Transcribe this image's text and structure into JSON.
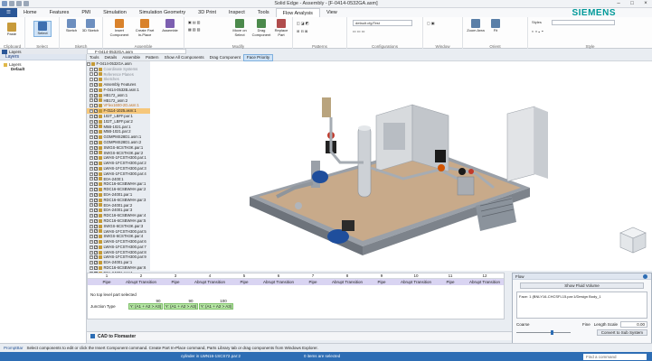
{
  "title": "Solid Edge - Assembly - [F-0414-0532GA.asm]",
  "brand": "SIEMENS",
  "menu_tabs": [
    "Home",
    "Features",
    "PMI",
    "Simulation",
    "Simulation Geometry",
    "3D Print",
    "Inspect",
    "Tools",
    "Flow Analysis",
    "View"
  ],
  "ribbon": {
    "groups": [
      "Clipboard",
      "Select",
      "Sketch",
      "Assemble",
      "Modify",
      "Patterns",
      "Configurations",
      "Window",
      "Orient",
      "Style"
    ],
    "buttons": {
      "paste": "Paste",
      "select": "Select",
      "sketch": "Sketch",
      "sketch_3d": "3D Sketch",
      "insert_component": "Insert Component",
      "create_part_inplace": "Create Part In-Place",
      "assemble": "Assemble",
      "move_on_select": "Move on Select",
      "drag_component": "Drag Component",
      "replace_part": "Replace Part",
      "zoom_area": "Zoom Area",
      "fit": "Fit",
      "styles_label": "Styles",
      "config_value": "default.cfg/Test"
    }
  },
  "left_panel": {
    "tabs": [
      "Layers"
    ],
    "title": "Layers",
    "items": [
      "Layers",
      "Default"
    ]
  },
  "doc_tab": "F-0414-0532GA.asm",
  "command_bar": [
    "Tools",
    "Details",
    "Assemble",
    "Pattern",
    "Show All Components",
    "Drag Component",
    "Face Priority"
  ],
  "tree": [
    {
      "label": "F-0414-0532GA.asm",
      "level": 0
    },
    {
      "label": "Coordinate Systems",
      "level": 1
    },
    {
      "label": "Reference Planes",
      "level": 1
    },
    {
      "label": "Sketches",
      "level": 1
    },
    {
      "label": "Assembly Features",
      "level": 1
    },
    {
      "label": "F-0414-0532B.asm:1",
      "level": 1
    },
    {
      "label": "HB172_asm:1",
      "level": 1
    },
    {
      "label": "HB172_asm:2",
      "level": 1
    },
    {
      "label": "VFlex1600-2D.asm:1",
      "level": 1
    },
    {
      "label": "F-0114-1025.asm:1",
      "level": 1
    },
    {
      "label": "102T_LBFF.par:1",
      "level": 1
    },
    {
      "label": "102T_LBFF.par:2",
      "level": 1
    },
    {
      "label": "M5B-1021.par:1",
      "level": 1
    },
    {
      "label": "M5B-1021.par:2",
      "level": 1
    },
    {
      "label": "GOMPMS28D1.asm:1",
      "level": 1
    },
    {
      "label": "GOMPMS28D1.asm:2",
      "level": 1
    },
    {
      "label": "SWGS-6CSTH3K.par:1",
      "level": 1
    },
    {
      "label": "SWGS-6CSTH3K.par:2",
      "level": 1
    },
    {
      "label": "LWHS-1FCSTH300.par:1",
      "level": 1
    },
    {
      "label": "LWHS-1FCSTH300.par:2",
      "level": 1
    },
    {
      "label": "LWHS-1FCSTH300.par:3",
      "level": 1
    },
    {
      "label": "LWHS-1FCSTH300.par:4",
      "level": 1
    },
    {
      "label": "E0A-2400:1",
      "level": 1
    },
    {
      "label": "RDC16-6CSBWHH.par:1",
      "level": 1
    },
    {
      "label": "RDC16-6CSBWHH.par:2",
      "level": 1
    },
    {
      "label": "E0A-24001.par:1",
      "level": 1
    },
    {
      "label": "RDC16-6CSBWHH.par:3",
      "level": 1
    },
    {
      "label": "E0A-24001.par:2",
      "level": 1
    },
    {
      "label": "E0A-24001.par:3",
      "level": 1
    },
    {
      "label": "RDC16-6CSBWHH.par:4",
      "level": 1
    },
    {
      "label": "RDC16-6CSBWHH.par:5",
      "level": 1
    },
    {
      "label": "SWGS-6CSTH3K.par:3",
      "level": 1
    },
    {
      "label": "LWHS-1FCSTH300.par:5",
      "level": 1
    },
    {
      "label": "SWGS-6CSTH3K.par:4",
      "level": 1
    },
    {
      "label": "LWHS-1FCSTH300.par:6",
      "level": 1
    },
    {
      "label": "LWHS-1FCSTH300.par:7",
      "level": 1
    },
    {
      "label": "LWHS-1FCSTH300.par:8",
      "level": 1
    },
    {
      "label": "LWHS-1FCSTH300.par:9",
      "level": 1
    },
    {
      "label": "E0A-24001.par:1",
      "level": 1
    },
    {
      "label": "RDC16-6CSBWHH.par:6",
      "level": 1
    },
    {
      "label": "E0A-24001.par:4",
      "level": 1
    },
    {
      "label": "Electric Panel.asm:1",
      "level": 1
    },
    {
      "label": "Electric Panel.asm:2",
      "level": 1
    },
    {
      "label": "OPHM-CSTH3K.par:1",
      "level": 1
    }
  ],
  "segments": {
    "numbers": [
      "1",
      "2",
      "3",
      "4",
      "5",
      "6",
      "7",
      "8",
      "9",
      "10",
      "11",
      "12"
    ],
    "types": [
      "Pipe",
      "Abrupt Transition",
      "Pipe",
      "Abrupt Transition",
      "Pipe",
      "Abrupt Transition",
      "Pipe",
      "Abrupt Transition",
      "Pipe",
      "Abrupt Transition",
      "Pipe",
      "Abrupt Transition"
    ],
    "status": "No top level part selected",
    "values": [
      "90",
      "90",
      "100"
    ],
    "junction_label": "Junction Type",
    "junctions": [
      "Y: (A1 + A2 > A3)",
      "Y: (A1 + A2 > A3)",
      "Y: (A1 + A2 > A3)"
    ]
  },
  "flow_panel": {
    "title": "Flow",
    "show_button": "Show Fluid Volume",
    "face_text": "Face: 1 (BNLY16-CHCSFL15.par:1/Design Body_1",
    "coarse_label": "Coarse",
    "fine_label": "Fine",
    "length_scale_label": "Length Scale",
    "length_scale_value": "0.00",
    "convert_button": "Convert to Sub System"
  },
  "bottom_tabs": [
    "CAD to Flomaster"
  ],
  "prompt_label": "PromptBar",
  "prompt_text": "Select components to edit or click the Insert Component command. Create Part In-Place command, Parts Library tab or drag components from Windows Explorer.",
  "status": {
    "left": "cylinder in LWN16-1SCS72.par:2",
    "mid": "0 items are selected",
    "find": "Find a command"
  },
  "colors": {
    "accent": "#2d6db4",
    "brand": "#009999",
    "part_plate": "#c8aa8a",
    "frame": "#8a8f97"
  }
}
